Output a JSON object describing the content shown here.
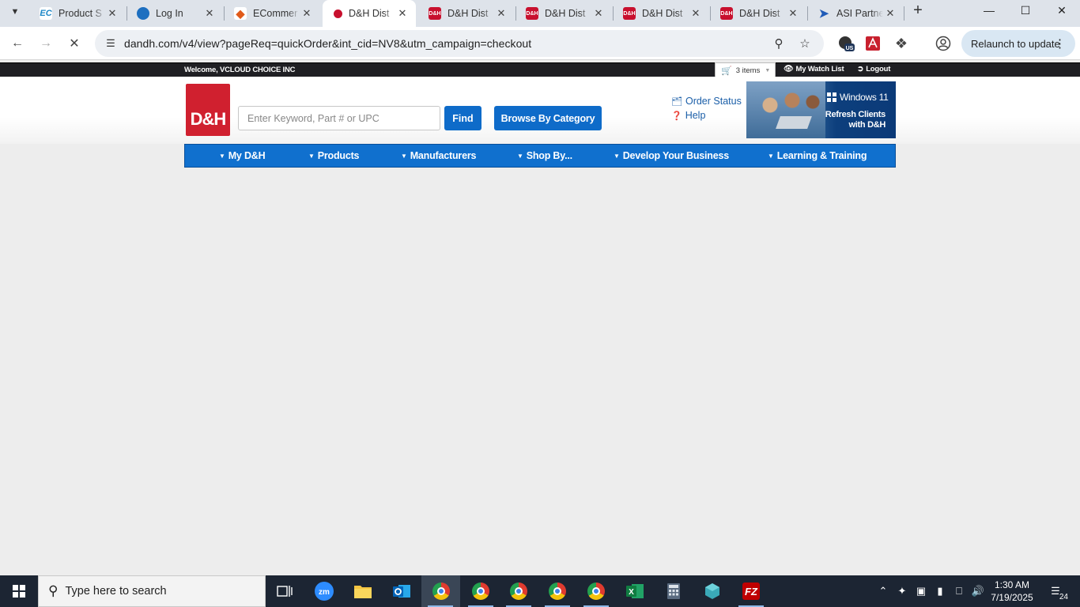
{
  "browser": {
    "tabs": [
      {
        "title": "Product S",
        "favicon": "EC"
      },
      {
        "title": "Log In",
        "favicon": "login-icon"
      },
      {
        "title": "ECommer",
        "favicon": "ecommerce-icon"
      },
      {
        "title": "D&H Dist",
        "favicon": "dh-icon",
        "active": true
      },
      {
        "title": "D&H Dist",
        "favicon": "D&H"
      },
      {
        "title": "D&H Dist",
        "favicon": "D&H"
      },
      {
        "title": "D&H Dist",
        "favicon": "D&H"
      },
      {
        "title": "D&H Dist",
        "favicon": "D&H"
      },
      {
        "title": "ASI Partne",
        "favicon": "asi-icon"
      }
    ],
    "url": "dandh.com/v4/view?pageReq=quickOrder&int_cid=NV8&utm_campaign=checkout",
    "relaunch_label": "Relaunch to update",
    "extension_badge": "US"
  },
  "page": {
    "welcome": "Welcome, VCLOUD CHOICE INC",
    "cart_label": "3 items",
    "watch_list": "My Watch List",
    "logout": "Logout",
    "logo_text": "D&H",
    "search_placeholder": "Enter Keyword, Part # or UPC",
    "find_label": "Find",
    "browse_label": "Browse By Category",
    "order_status": "Order Status",
    "help": "Help",
    "banner": {
      "product": "Windows 11",
      "tagline_line1": "Refresh Clients",
      "tagline_line2": "with D&H"
    },
    "nav": [
      "My D&H",
      "Products",
      "Manufacturers",
      "Shop By...",
      "Develop Your Business",
      "Learning & Training"
    ]
  },
  "taskbar": {
    "search_placeholder": "Type here to search",
    "time": "1:30 AM",
    "date": "7/19/2025",
    "notification_count": "24",
    "apps": [
      "task-view",
      "zoom",
      "file-explorer",
      "outlook",
      "chrome",
      "chrome",
      "chrome",
      "chrome",
      "chrome",
      "excel",
      "calculator",
      "app",
      "filezilla"
    ]
  },
  "colors": {
    "brand_red": "#d0202f",
    "brand_blue": "#0e6bc9",
    "nav_blue": "#1070ce",
    "top_strip": "#1f1f23"
  }
}
